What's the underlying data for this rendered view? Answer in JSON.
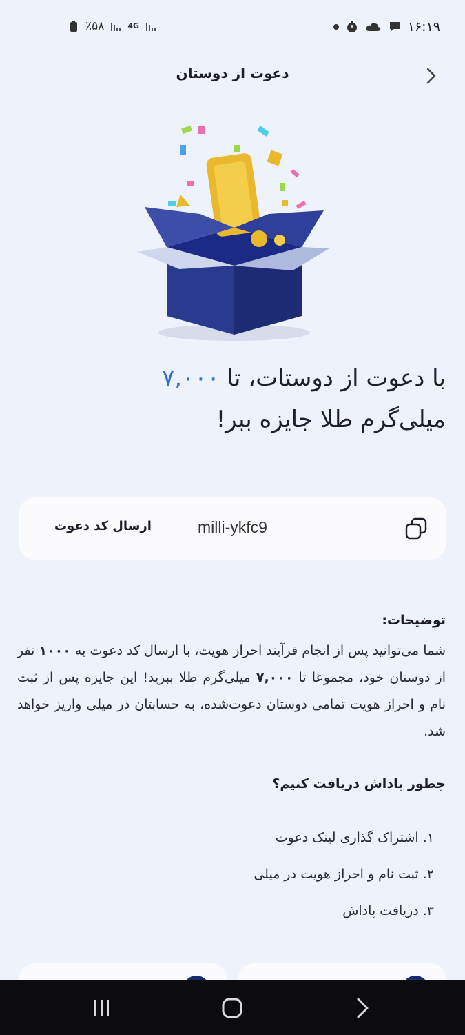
{
  "status_bar": {
    "time": "۱۶:۱۹",
    "battery": "٪۵۸",
    "network": "4G"
  },
  "header": {
    "title": "دعوت از دوستان",
    "back_icon": "chevron-right-icon"
  },
  "hero": {
    "icon": "gift-box-illustration"
  },
  "headline": {
    "prefix": "با دعوت از دوستات، تا ",
    "amount": "۷,۰۰۰",
    "suffix": "میلی‌گرم طلا جایزه ببر!"
  },
  "invite": {
    "code": "milli-ykfc9",
    "send_label": "ارسال کد دعوت",
    "copy_icon": "copy-icon"
  },
  "description": {
    "title": "توضیحات:",
    "part1": "شما می‌توانید پس از انجام فرآیند احراز هویت، با ارسال کد دعوت به ",
    "count": "۱۰۰۰",
    "part2": " نفر از دوستان خود، مجموعا تا ",
    "amount": "۷,۰۰۰",
    "part3": " میلی‌گرم طلا ببرید! این جایزه پس از ثبت نام و احراز هویت تمامی دوستان دعوت‌شده، به حسابتان در میلی واریز خواهد شد."
  },
  "how": {
    "title": "چطور پاداش دریافت کنیم؟",
    "steps": [
      "۱. اشتراک گذاری لینک دعوت",
      "۲. ثبت نام و احراز هویت در میلی",
      "۳. دریافت پاداش"
    ]
  },
  "nav": {
    "recent_icon": "recent-apps-icon",
    "home_icon": "home-icon",
    "back_icon": "back-icon"
  },
  "colors": {
    "background": "#eef2fb",
    "accent": "#2b6fd6",
    "card": "#fbfbfd",
    "navy": "#1a2a6e"
  }
}
